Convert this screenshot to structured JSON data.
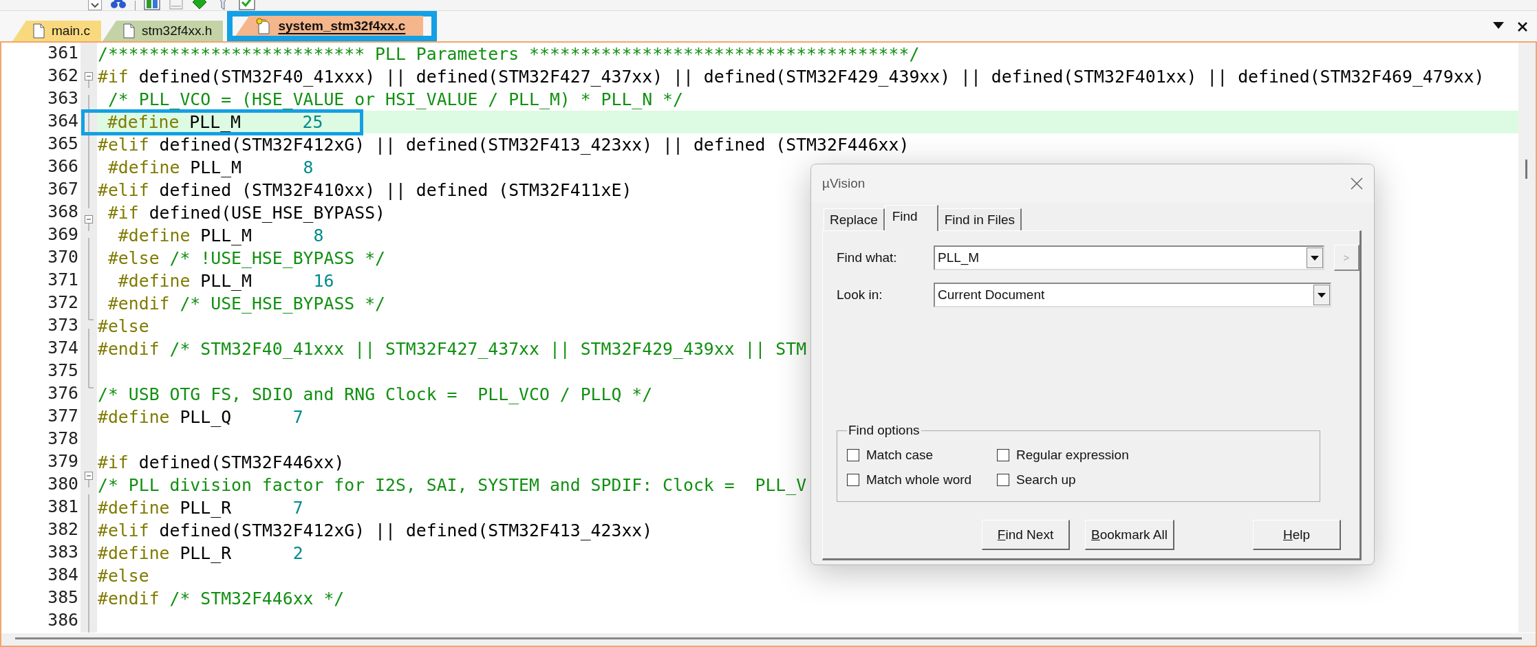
{
  "file_tabs": [
    {
      "label": "main.c",
      "selected": false,
      "color": "#f8d97e",
      "kind": "file"
    },
    {
      "label": "stm32f4xx.h",
      "selected": false,
      "color": "#c4d3a6",
      "kind": "file"
    },
    {
      "label": "system_stm32f4xx.c",
      "selected": true,
      "color": "#f4b68a",
      "kind": "keyed-file"
    }
  ],
  "editor": {
    "lines": [
      {
        "number": "361",
        "kind": "plain",
        "current": false,
        "tokens": [
          {
            "kind": "comment",
            "text": "/************************* PLL Parameters *************************************/"
          }
        ]
      },
      {
        "number": "362",
        "kind": "fold-start",
        "current": false,
        "tokens": [
          {
            "kind": "directive",
            "text": "#if"
          },
          {
            "kind": "plain",
            "text": " defined(STM32F40_41xxx) || defined(STM32F427_437xx) || defined(STM32F429_439xx) || defined(STM32F401xx) || defined(STM32F469_479xx)"
          }
        ]
      },
      {
        "number": "363",
        "kind": "fold-body",
        "current": false,
        "tokens": [
          {
            "kind": "comment",
            "text": " /* PLL_VCO = (HSE_VALUE or HSI_VALUE / PLL_M) * PLL_N */"
          }
        ]
      },
      {
        "number": "364",
        "kind": "fold-body",
        "current": true,
        "tokens": [
          {
            "kind": "directive",
            "text": " #define"
          },
          {
            "kind": "plain",
            "text": " PLL_M      "
          },
          {
            "kind": "number",
            "text": "25"
          }
        ]
      },
      {
        "number": "365",
        "kind": "fold-body",
        "current": false,
        "tokens": [
          {
            "kind": "directive",
            "text": "#elif"
          },
          {
            "kind": "plain",
            "text": " defined(STM32F412xG) || defined(STM32F413_423xx) || defined (STM32F446xx)"
          }
        ]
      },
      {
        "number": "366",
        "kind": "fold-body",
        "current": false,
        "tokens": [
          {
            "kind": "directive",
            "text": " #define"
          },
          {
            "kind": "plain",
            "text": " PLL_M      "
          },
          {
            "kind": "number",
            "text": "8"
          }
        ]
      },
      {
        "number": "367",
        "kind": "fold-body",
        "current": false,
        "tokens": [
          {
            "kind": "directive",
            "text": "#elif"
          },
          {
            "kind": "plain",
            "text": " defined (STM32F410xx) || defined (STM32F411xE)"
          }
        ]
      },
      {
        "number": "368",
        "kind": "fold-start",
        "current": false,
        "tokens": [
          {
            "kind": "directive",
            "text": " #if"
          },
          {
            "kind": "plain",
            "text": " defined(USE_HSE_BYPASS)"
          }
        ]
      },
      {
        "number": "369",
        "kind": "fold-body",
        "current": false,
        "tokens": [
          {
            "kind": "directive",
            "text": "  #define"
          },
          {
            "kind": "plain",
            "text": " PLL_M      "
          },
          {
            "kind": "number",
            "text": "8"
          }
        ]
      },
      {
        "number": "370",
        "kind": "fold-body",
        "current": false,
        "tokens": [
          {
            "kind": "directive",
            "text": " #else"
          },
          {
            "kind": "comment",
            "text": " /* !USE_HSE_BYPASS */"
          }
        ]
      },
      {
        "number": "371",
        "kind": "fold-body",
        "current": false,
        "tokens": [
          {
            "kind": "directive",
            "text": "  #define"
          },
          {
            "kind": "plain",
            "text": " PLL_M      "
          },
          {
            "kind": "number",
            "text": "16"
          }
        ]
      },
      {
        "number": "372",
        "kind": "fold-end",
        "current": false,
        "tokens": [
          {
            "kind": "directive",
            "text": " #endif"
          },
          {
            "kind": "comment",
            "text": " /* USE_HSE_BYPASS */"
          }
        ]
      },
      {
        "number": "373",
        "kind": "fold-body",
        "current": false,
        "tokens": [
          {
            "kind": "directive",
            "text": "#else"
          }
        ]
      },
      {
        "number": "374",
        "kind": "fold-body",
        "current": false,
        "tokens": [
          {
            "kind": "directive",
            "text": "#endif"
          },
          {
            "kind": "comment",
            "text": " /* STM32F40_41xxx || STM32F427_437xx || STM32F429_439xx || STM"
          }
        ]
      },
      {
        "number": "375",
        "kind": "fold-end",
        "current": false
      },
      {
        "number": "376",
        "kind": "plain",
        "current": false,
        "tokens": [
          {
            "kind": "comment",
            "text": "/* USB OTG FS, SDIO and RNG Clock =  PLL_VCO / PLLQ */"
          }
        ]
      },
      {
        "number": "377",
        "kind": "plain",
        "current": false,
        "tokens": [
          {
            "kind": "directive",
            "text": "#define"
          },
          {
            "kind": "plain",
            "text": " PLL_Q      "
          },
          {
            "kind": "number",
            "text": "7"
          }
        ]
      },
      {
        "number": "378",
        "kind": "plain",
        "current": false
      },
      {
        "number": "379",
        "kind": "fold-start",
        "current": false,
        "tokens": [
          {
            "kind": "directive",
            "text": "#if"
          },
          {
            "kind": "plain",
            "text": " defined(STM32F446xx)"
          }
        ]
      },
      {
        "number": "380",
        "kind": "fold-body",
        "current": false,
        "tokens": [
          {
            "kind": "comment",
            "text": "/* PLL division factor for I2S, SAI, SYSTEM and SPDIF: Clock =  PLL_V"
          }
        ]
      },
      {
        "number": "381",
        "kind": "fold-body",
        "current": false,
        "tokens": [
          {
            "kind": "directive",
            "text": "#define"
          },
          {
            "kind": "plain",
            "text": " PLL_R      "
          },
          {
            "kind": "number",
            "text": "7"
          }
        ]
      },
      {
        "number": "382",
        "kind": "fold-body",
        "current": false,
        "tokens": [
          {
            "kind": "directive",
            "text": "#elif"
          },
          {
            "kind": "plain",
            "text": " defined(STM32F412xG) || defined(STM32F413_423xx)"
          }
        ]
      },
      {
        "number": "383",
        "kind": "fold-body",
        "current": false,
        "tokens": [
          {
            "kind": "directive",
            "text": "#define"
          },
          {
            "kind": "plain",
            "text": " PLL_R      "
          },
          {
            "kind": "number",
            "text": "2"
          }
        ]
      },
      {
        "number": "384",
        "kind": "fold-body",
        "current": false,
        "tokens": [
          {
            "kind": "directive",
            "text": "#else"
          }
        ]
      },
      {
        "number": "385",
        "kind": "fold-body",
        "current": false,
        "tokens": [
          {
            "kind": "directive",
            "text": "#endif"
          },
          {
            "kind": "comment",
            "text": " /* STM32F446xx */"
          }
        ]
      },
      {
        "number": "386",
        "kind": "fold-end",
        "current": false
      }
    ]
  },
  "dialog": {
    "title": "µVision",
    "tabs": [
      {
        "label": "Replace",
        "selected": false
      },
      {
        "label": "Find",
        "selected": true
      },
      {
        "label": "Find in Files",
        "selected": false
      }
    ],
    "fields": [
      {
        "label": "Find what:",
        "value": "PLL_M"
      },
      {
        "label": "Look in:",
        "value": "Current Document"
      }
    ],
    "more_button": {
      "label": ">",
      "disabled": true
    },
    "options_group": {
      "title": "Find options",
      "options": [
        {
          "label": "Match case",
          "checked": false
        },
        {
          "label": "Regular expression",
          "checked": false
        },
        {
          "label": "Match whole word",
          "checked": false
        },
        {
          "label": "Search up",
          "checked": false
        }
      ]
    },
    "buttons": [
      {
        "accel": "F",
        "rest": "ind Next"
      },
      {
        "accel": "B",
        "rest": "ookmark All"
      },
      {
        "accel": "H",
        "rest": "elp"
      }
    ]
  }
}
